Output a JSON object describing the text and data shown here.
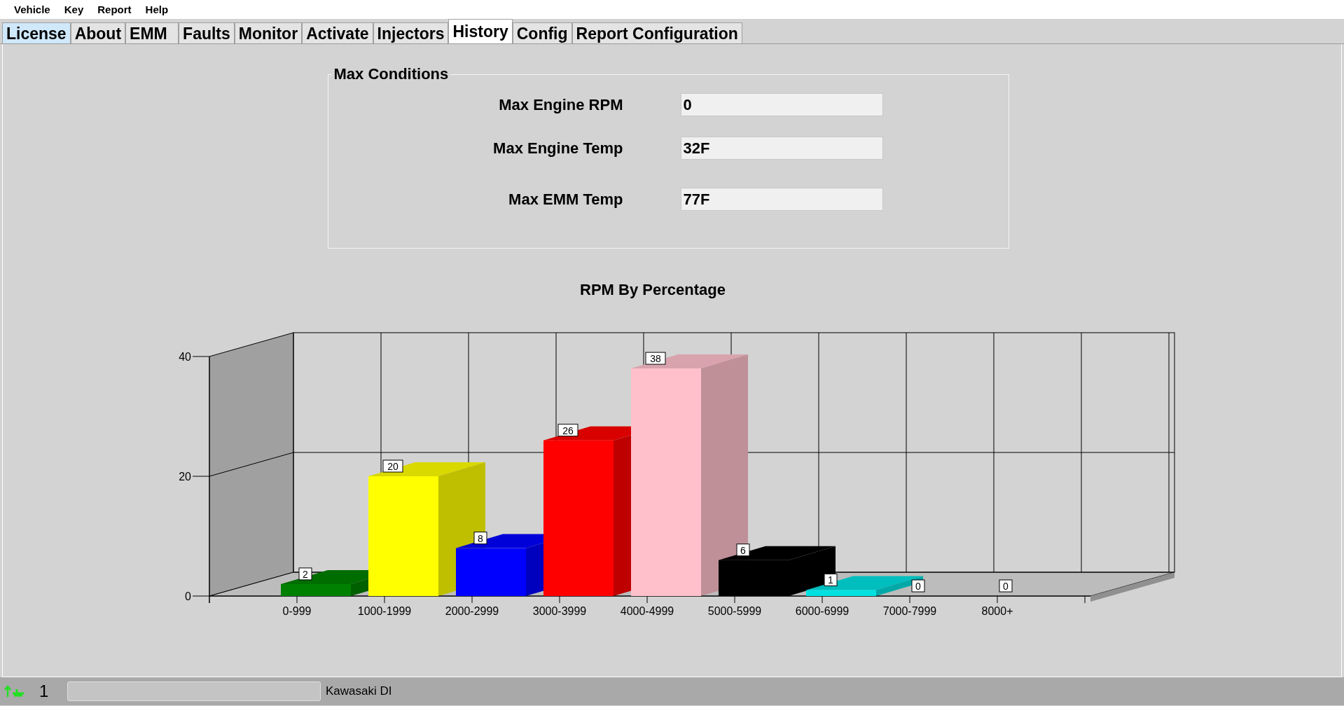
{
  "menu": [
    "Vehicle",
    "Key",
    "Report",
    "Help"
  ],
  "tabs": [
    {
      "label": "License",
      "selected": false,
      "highlighted": true
    },
    {
      "label": "About",
      "selected": false,
      "highlighted": false
    },
    {
      "label": "EMM",
      "selected": false,
      "highlighted": false
    },
    {
      "label": "Faults",
      "selected": false,
      "highlighted": false
    },
    {
      "label": "Monitor",
      "selected": false,
      "highlighted": false
    },
    {
      "label": "Activate",
      "selected": false,
      "highlighted": false
    },
    {
      "label": "Injectors",
      "selected": false,
      "highlighted": false
    },
    {
      "label": "History",
      "selected": true,
      "highlighted": false
    },
    {
      "label": "Config",
      "selected": false,
      "highlighted": false
    },
    {
      "label": "Report Configuration",
      "selected": false,
      "highlighted": false
    }
  ],
  "max_conditions": {
    "title": "Max Conditions",
    "fields": [
      {
        "label": "Max Engine RPM",
        "value": "0"
      },
      {
        "label": "Max Engine Temp",
        "value": "32F"
      },
      {
        "label": "Max EMM Temp",
        "value": "77F"
      }
    ]
  },
  "chart_data": {
    "type": "bar",
    "title": "RPM By Percentage",
    "categories": [
      "0-999",
      "1000-1999",
      "2000-2999",
      "3000-3999",
      "4000-4999",
      "5000-5999",
      "6000-6999",
      "7000-7999",
      "8000+"
    ],
    "series": [
      {
        "values": [
          2,
          20,
          8,
          26,
          38,
          6,
          1,
          0,
          0
        ],
        "colors": [
          "#008000",
          "#ffff00",
          "#0000ff",
          "#ff0000",
          "#ffc0cb",
          "#000000",
          "#00e0e0",
          "#808080",
          "#808080"
        ]
      }
    ],
    "ylim": [
      0,
      40
    ],
    "yticks": [
      0,
      20,
      40
    ],
    "data_labels": true
  },
  "status_bar": {
    "count": "1",
    "progress": {
      "level": 0
    },
    "label": "Kawasaki DI"
  }
}
